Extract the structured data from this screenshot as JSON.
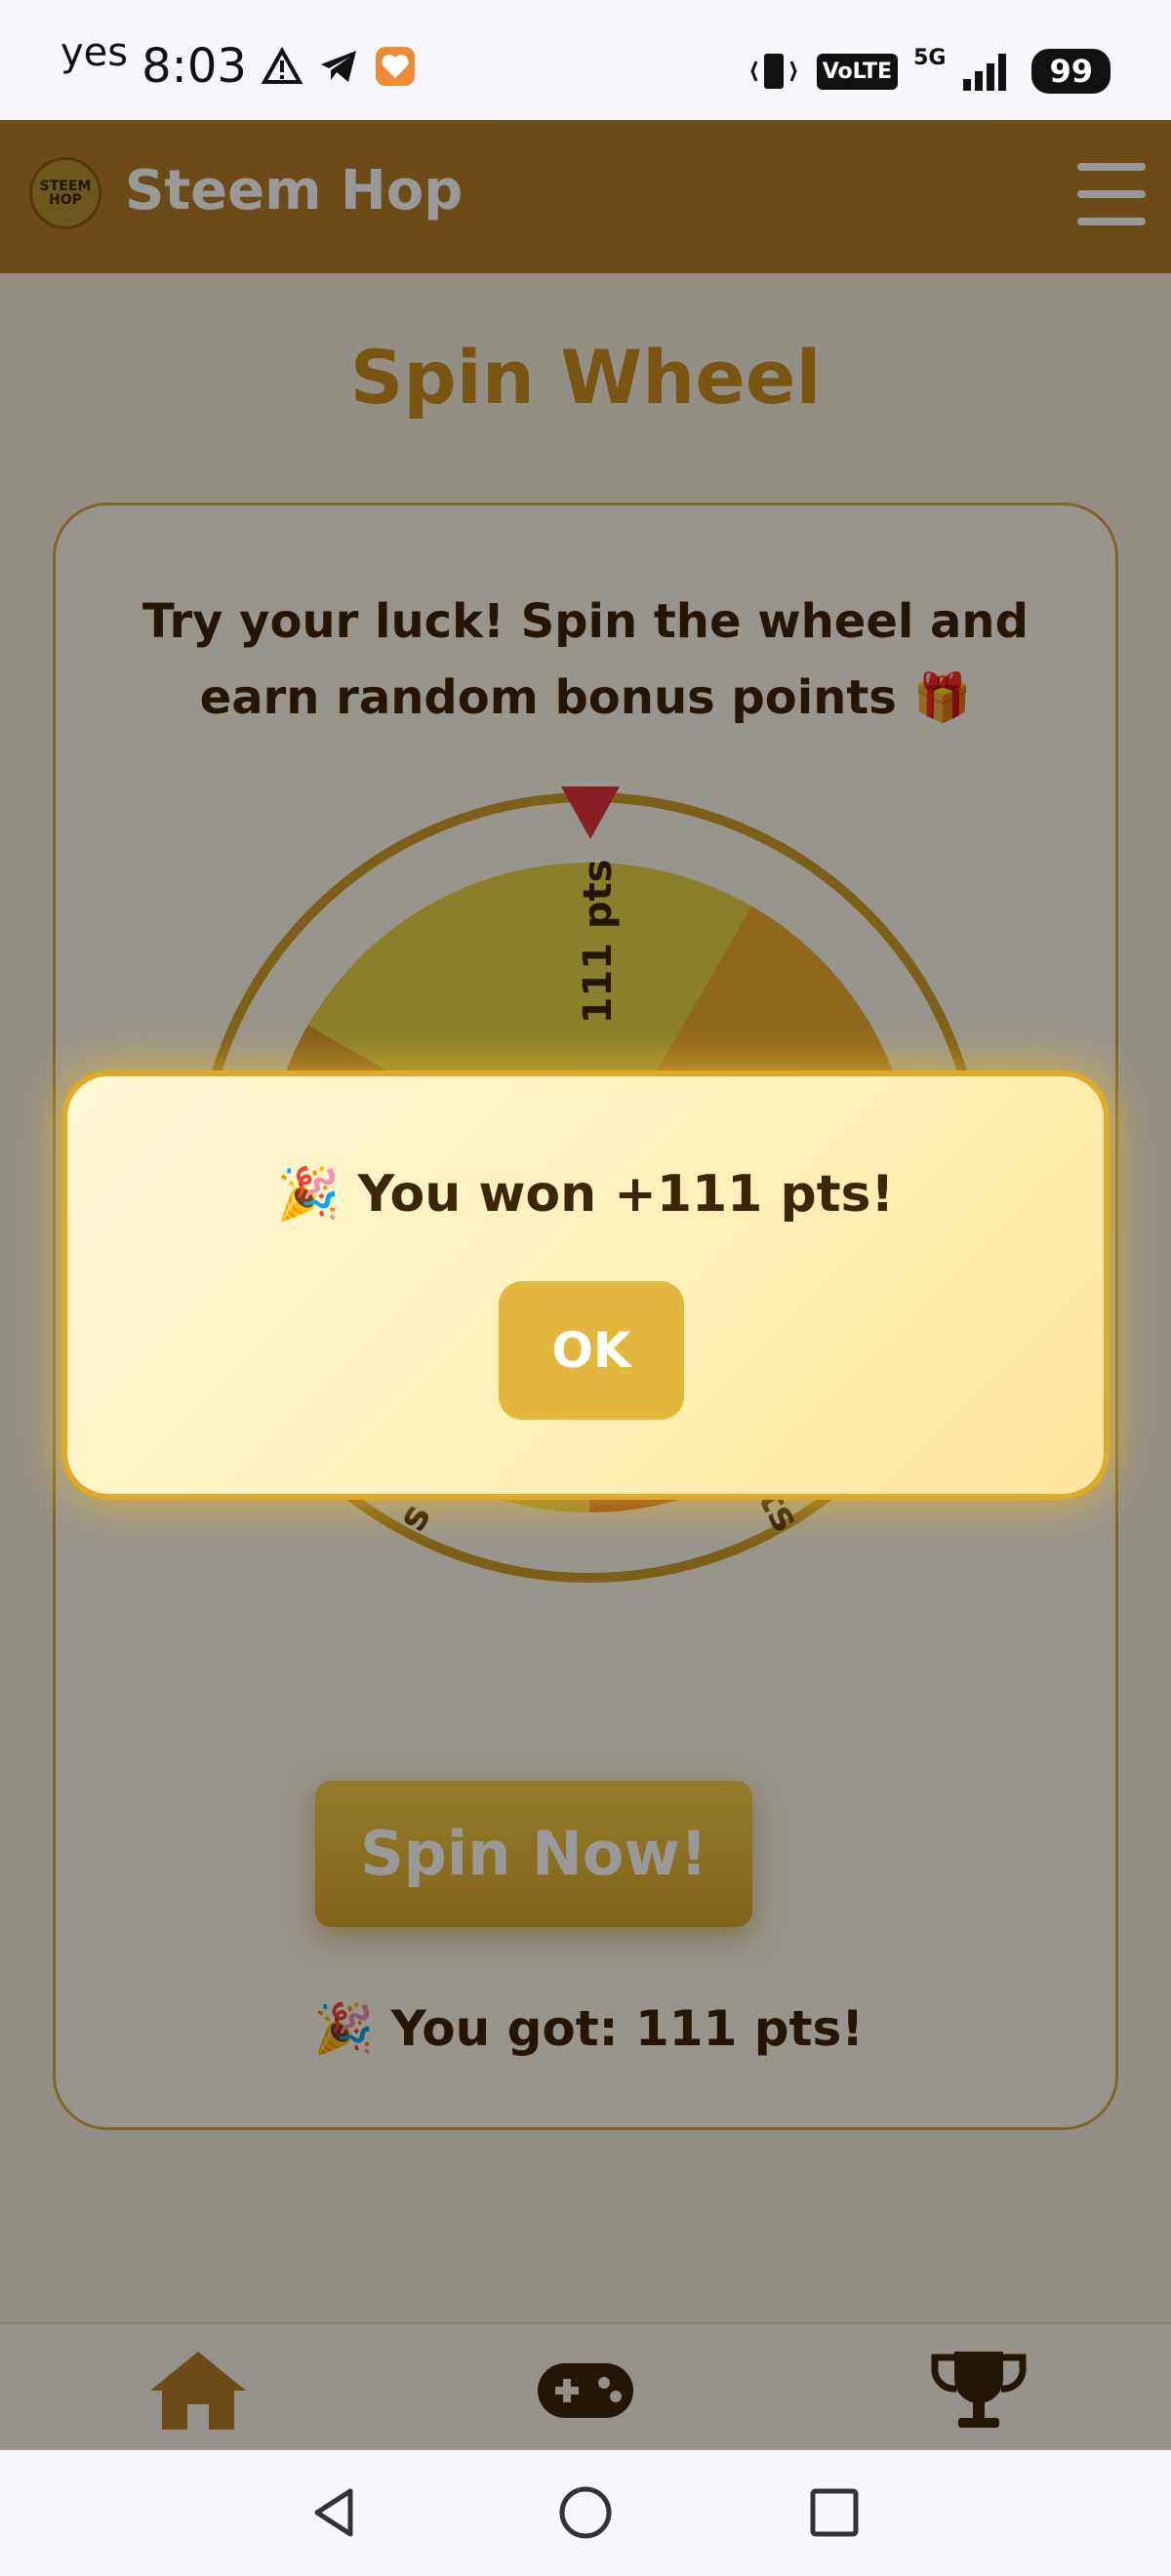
{
  "status_bar": {
    "carrier": "yes",
    "time": "8:03",
    "network": "5G",
    "volte": "VoLTE",
    "battery": "99"
  },
  "header": {
    "logo_text": "STEEM HOP",
    "title": "Steem Hop"
  },
  "page": {
    "title": "Spin Wheel"
  },
  "card": {
    "intro": "Try your luck! Spin the wheel and earn random bonus points 🎁",
    "wheel": {
      "top_segment_label": "111 pts",
      "bottom_right_label": "pts",
      "bottom_left_label": "s"
    },
    "spin_button": "Spin Now!",
    "result": "🎉 You got: 111 pts!"
  },
  "dialog": {
    "message": "🎉 You won +111 pts!",
    "ok_button": "OK"
  },
  "bottom_nav": {
    "items": [
      {
        "icon": "home-icon"
      },
      {
        "icon": "gamepad-icon"
      },
      {
        "icon": "trophy-icon"
      }
    ]
  },
  "colors": {
    "header": "#b47e2b",
    "accent": "#e3b63e",
    "title": "#c8901d",
    "text": "#3d2605"
  }
}
